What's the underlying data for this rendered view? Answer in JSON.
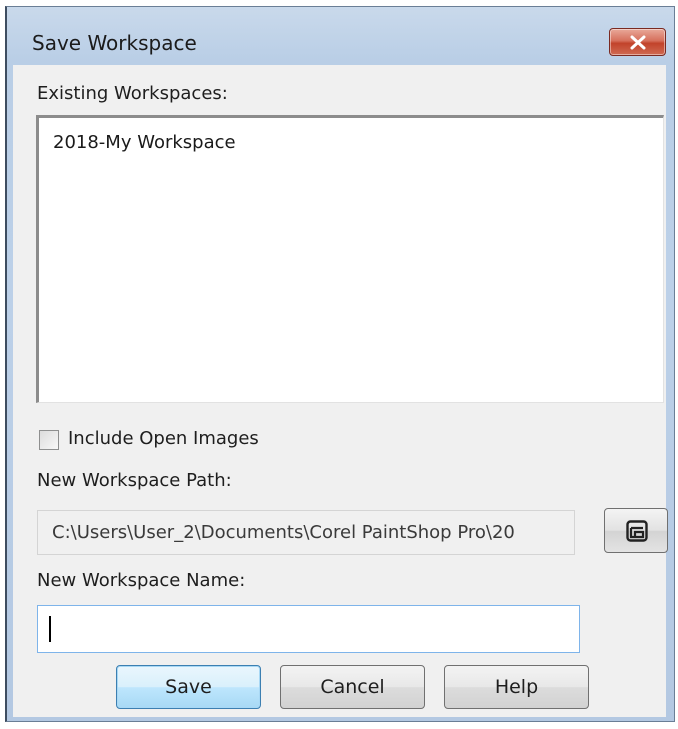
{
  "window": {
    "title": "Save Workspace",
    "close_icon": "close-icon"
  },
  "existing": {
    "label": "Existing Workspaces:",
    "items": [
      "2018-My Workspace"
    ]
  },
  "include_open_images": {
    "label": "Include Open Images",
    "checked": false
  },
  "path": {
    "label": "New Workspace Path:",
    "value": "C:\\Users\\User_2\\Documents\\Corel PaintShop Pro\\20",
    "browse_icon": "browse-folder-icon"
  },
  "name": {
    "label": "New Workspace Name:",
    "value": ""
  },
  "buttons": {
    "save": "Save",
    "cancel": "Cancel",
    "help": "Help"
  },
  "colors": {
    "frame": "#b9cee6",
    "close_button": "#c2432b",
    "default_button": "#bee6fd",
    "input_focus_border": "#7eb4ea"
  }
}
